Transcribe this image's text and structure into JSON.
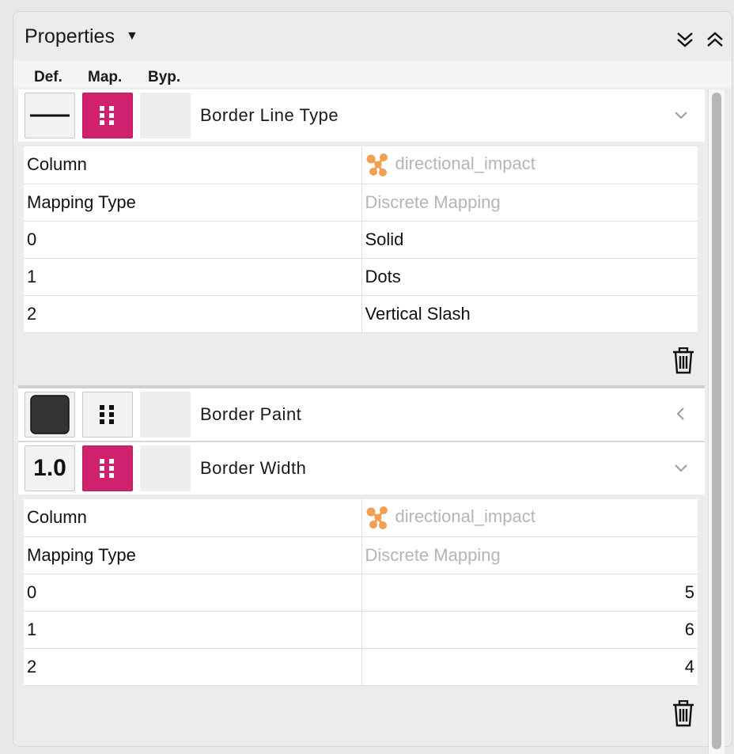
{
  "header": {
    "title": "Properties"
  },
  "columns": {
    "def": "Def.",
    "map": "Map.",
    "byp": "Byp."
  },
  "colors": {
    "accent": "#d0216e",
    "icon_orange": "#f0a050"
  },
  "sections": [
    {
      "label": "Border Line Type",
      "def_icon": "line-icon",
      "rows": [
        {
          "key": "Column",
          "value": "directional_impact"
        },
        {
          "key": "Mapping Type",
          "value": "Discrete Mapping"
        },
        {
          "key": "0",
          "value": "Solid"
        },
        {
          "key": "1",
          "value": "Dots"
        },
        {
          "key": "2",
          "value": "Vertical Slash"
        }
      ]
    },
    {
      "label": "Border Paint",
      "def_icon": "color-swatch-icon"
    },
    {
      "label": "Border Width",
      "def_value": "1.0",
      "rows": [
        {
          "key": "Column",
          "value": "directional_impact"
        },
        {
          "key": "Mapping Type",
          "value": "Discrete Mapping"
        },
        {
          "key": "0",
          "value": "5"
        },
        {
          "key": "1",
          "value": "6"
        },
        {
          "key": "2",
          "value": "4"
        }
      ]
    }
  ]
}
